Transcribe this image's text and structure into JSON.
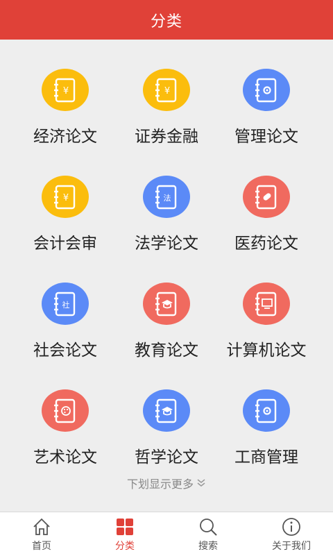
{
  "header": {
    "title": "分类"
  },
  "colors": {
    "accent": "#e04138",
    "yellow": "#fbbd0d",
    "blue": "#5b8af7",
    "red": "#f06a5f"
  },
  "categories": [
    {
      "label": "经济论文",
      "color": "#fbbd0d",
      "glyph": "¥",
      "icon": "yen-notebook-icon"
    },
    {
      "label": "证券金融",
      "color": "#fbbd0d",
      "glyph": "¥",
      "icon": "yen-notebook-icon"
    },
    {
      "label": "管理论文",
      "color": "#5b8af7",
      "glyph": "⚙",
      "icon": "gear-notebook-icon"
    },
    {
      "label": "会计会审",
      "color": "#fbbd0d",
      "glyph": "¥",
      "icon": "yen-notebook-icon"
    },
    {
      "label": "法学论文",
      "color": "#5b8af7",
      "glyph": "法",
      "icon": "law-notebook-icon"
    },
    {
      "label": "医药论文",
      "color": "#f06a5f",
      "glyph": "💊",
      "icon": "pill-notebook-icon"
    },
    {
      "label": "社会论文",
      "color": "#5b8af7",
      "glyph": "社",
      "icon": "society-notebook-icon"
    },
    {
      "label": "教育论文",
      "color": "#f06a5f",
      "glyph": "🎓",
      "icon": "graduation-cap-notebook-icon"
    },
    {
      "label": "计算机论文",
      "color": "#f06a5f",
      "glyph": "🖥",
      "icon": "computer-notebook-icon"
    },
    {
      "label": "艺术论文",
      "color": "#f06a5f",
      "glyph": "🎨",
      "icon": "palette-notebook-icon"
    },
    {
      "label": "哲学论文",
      "color": "#5b8af7",
      "glyph": "🎓",
      "icon": "graduation-cap-notebook-icon"
    },
    {
      "label": "工商管理",
      "color": "#5b8af7",
      "glyph": "⚙",
      "icon": "gear-notebook-icon"
    }
  ],
  "hint": {
    "text": "下划显示更多"
  },
  "tabs": [
    {
      "label": "首页",
      "icon": "home-icon"
    },
    {
      "label": "分类",
      "icon": "grid-icon",
      "active": true
    },
    {
      "label": "搜索",
      "icon": "search-icon"
    },
    {
      "label": "关于我们",
      "icon": "info-icon"
    }
  ]
}
